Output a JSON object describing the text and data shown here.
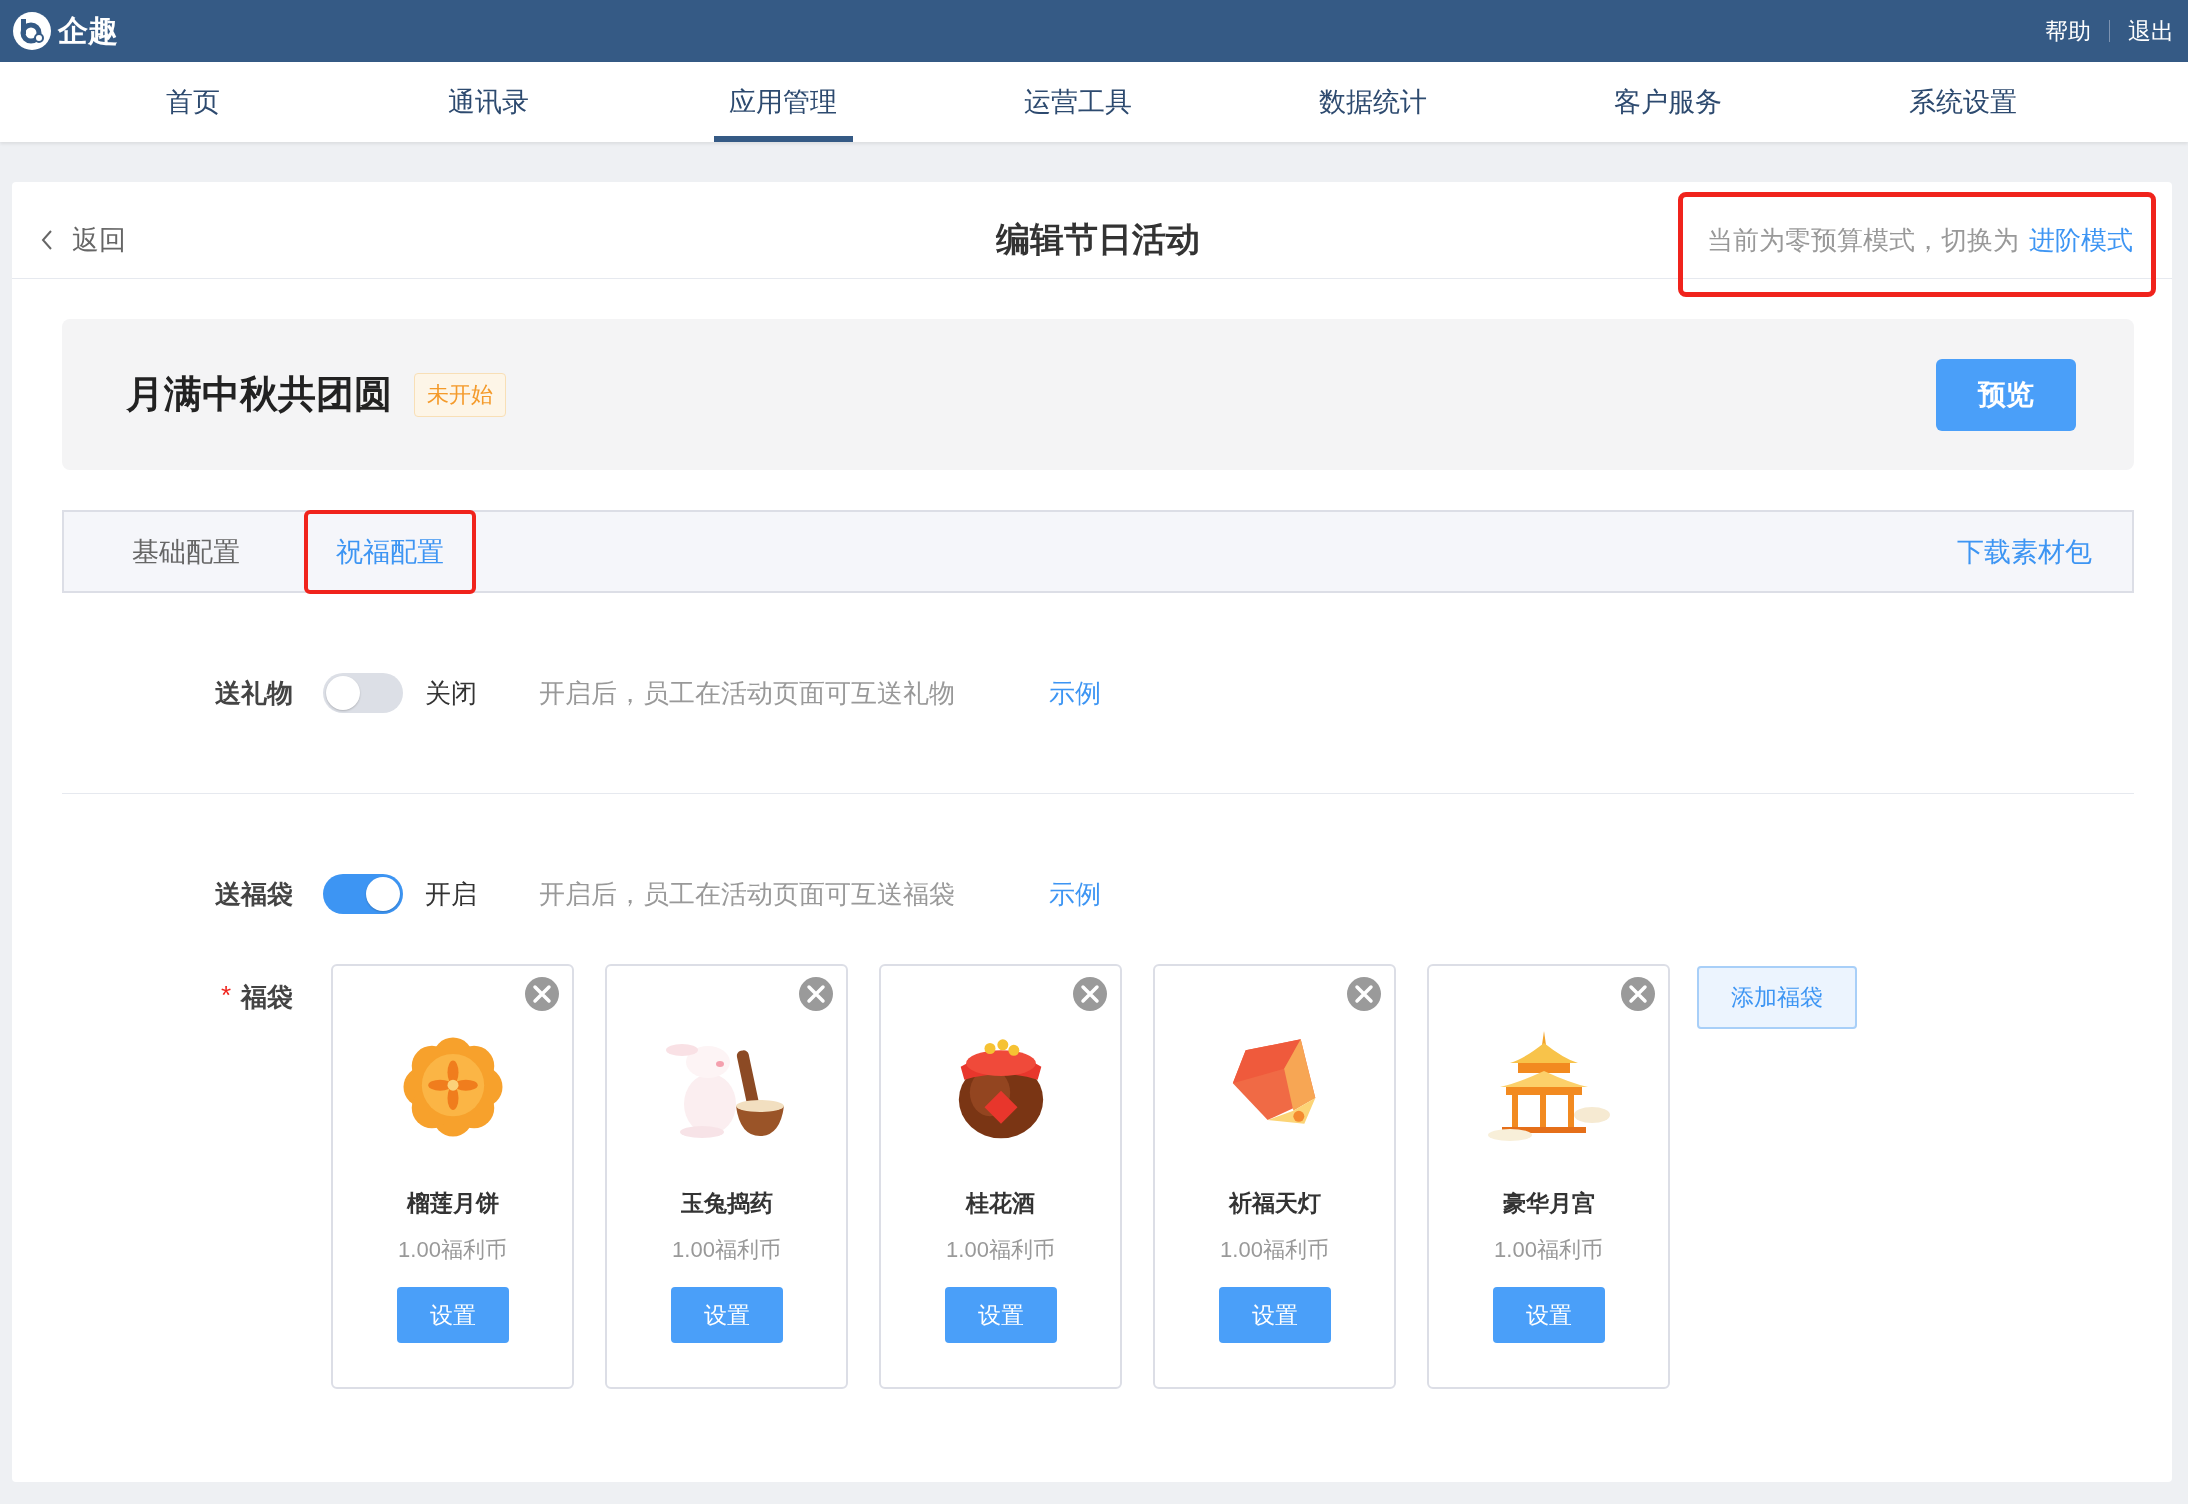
{
  "top_bar": {
    "brand": "企趣",
    "links": [
      "帮助",
      "退出"
    ]
  },
  "nav": [
    {
      "label": "首页",
      "selected": false
    },
    {
      "label": "通讯录",
      "selected": false
    },
    {
      "label": "应用管理",
      "selected": true
    },
    {
      "label": "运营工具",
      "selected": false
    },
    {
      "label": "数据统计",
      "selected": false
    },
    {
      "label": "客户服务",
      "selected": false
    },
    {
      "label": "系统设置",
      "selected": false
    }
  ],
  "header": {
    "back": "返回",
    "title": "编辑节日活动",
    "mode_notice": {
      "text": "当前为零预算模式，切换为",
      "link": "进阶模式",
      "highlighted": true
    }
  },
  "banner": {
    "title": "月满中秋共团圆",
    "status": "未开始",
    "preview_button": "预览"
  },
  "tabs": [
    {
      "label": "基础配置",
      "selected": false,
      "highlighted": false
    },
    {
      "label": "祝福配置",
      "selected": true,
      "highlighted": true
    }
  ],
  "download_link": "下载素材包",
  "settings": [
    {
      "label": "送礼物",
      "on": false,
      "state_text": "关闭",
      "hint": "开启后，员工在活动页面可互送礼物",
      "example": "示例"
    },
    {
      "label": "送福袋",
      "on": true,
      "state_text": "开启",
      "hint": "开启后，员工在活动页面可互送福袋",
      "example": "示例"
    }
  ],
  "bags": {
    "required_mark": "*",
    "label": "福袋",
    "add_button": "添加福袋",
    "items": [
      {
        "kind": "mooncake",
        "name": "榴莲月饼",
        "price": "1.00福利币",
        "button": "设置"
      },
      {
        "kind": "rabbit",
        "name": "玉兔捣药",
        "price": "1.00福利币",
        "button": "设置"
      },
      {
        "kind": "jar",
        "name": "桂花酒",
        "price": "1.00福利币",
        "button": "设置"
      },
      {
        "kind": "lantern",
        "name": "祈福天灯",
        "price": "1.00福利币",
        "button": "设置"
      },
      {
        "kind": "pavilion",
        "name": "豪华月宫",
        "price": "1.00福利币",
        "button": "设置"
      }
    ]
  }
}
